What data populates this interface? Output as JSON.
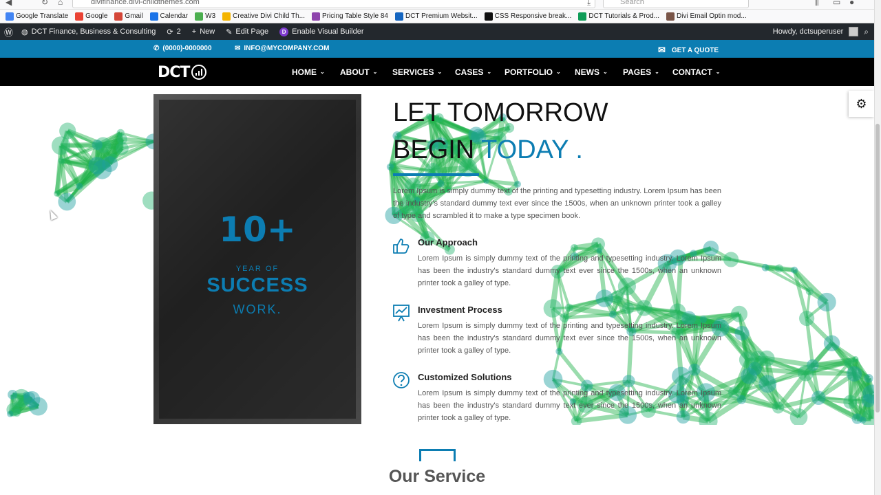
{
  "browser": {
    "url": "divifinance.divi-childthemes.com",
    "search_placeholder": "Search",
    "bookmarks": [
      {
        "label": "Google Translate",
        "icon": "translate-icon",
        "color": "#4285f4"
      },
      {
        "label": "Google",
        "icon": "google-icon",
        "color": "#ea4335"
      },
      {
        "label": "Gmail",
        "icon": "gmail-icon",
        "color": "#d44638"
      },
      {
        "label": "Calendar",
        "icon": "calendar-icon",
        "color": "#1a73e8"
      },
      {
        "label": "W3",
        "icon": "w3-icon",
        "color": "#4caf50"
      },
      {
        "label": "Creative Divi Child Th...",
        "icon": "pencil-icon",
        "color": "#f4b400"
      },
      {
        "label": "Pricing Table Style 84",
        "icon": "jr-icon",
        "color": "#8e44ad"
      },
      {
        "label": "DCT Premium Websit...",
        "icon": "dct-icon",
        "color": "#1565c0"
      },
      {
        "label": "CSS Responsive break...",
        "icon": "github-icon",
        "color": "#111111"
      },
      {
        "label": "DCT Tutorials & Prod...",
        "icon": "sheet-icon",
        "color": "#0f9d58"
      },
      {
        "label": "Divi Email Optin mod...",
        "icon": "gear-icon",
        "color": "#795548"
      }
    ]
  },
  "adminbar": {
    "site_name": "DCT Finance, Business & Consulting",
    "updates_count": "2",
    "new_label": "New",
    "edit_label": "Edit Page",
    "visual_builder_label": "Enable Visual Builder",
    "greeting": "Howdy, dctsuperuser"
  },
  "topbar": {
    "phone": "(0000)-0000000",
    "email": "INFO@MYCOMPANY.COM",
    "quote": "GET A QUOTE"
  },
  "header": {
    "logo_text": "DCT",
    "menu": [
      "HOME",
      "ABOUT",
      "SERVICES",
      "CASES",
      "PORTFOLIO",
      "NEWS",
      "PAGES",
      "CONTACT"
    ]
  },
  "hero": {
    "stat_number": "10+",
    "stat_line1": "YEAR OF",
    "stat_line2": "SUCCESS",
    "stat_line3": "WORK.",
    "heading_line1": "LET TOMORROW",
    "heading_line2_a": "BEGIN ",
    "heading_line2_b": "TODAY .",
    "intro": "Lorem Ipsum is simply dummy text of the printing and typesetting industry. Lorem Ipsum has been the industry's standard dummy text ever since the 1500s, when an unknown printer took a galley of type and scrambled it to make a type specimen book.",
    "features": [
      {
        "title": "Our Approach",
        "icon": "thumbs-up-icon",
        "body": "Lorem Ipsum is simply dummy text of the printing and typesetting industry. Lorem Ipsum has been the industry's standard dummy text ever since the 1500s, when an unknown printer took a galley of type."
      },
      {
        "title": "Investment Process",
        "icon": "chart-board-icon",
        "body": "Lorem Ipsum is simply dummy text of the printing and typesetting industry. Lorem Ipsum has been the industry's standard dummy text ever since the 1500s, when an unknown printer took a galley of type."
      },
      {
        "title": "Customized Solutions",
        "icon": "question-circle-icon",
        "body": "Lorem Ipsum is simply dummy text of the printing and typesetting industry. Lorem Ipsum has been the industry's standard dummy text ever since the 1500s, when an unknown printer took a galley of type."
      }
    ]
  },
  "service": {
    "title": "Our Service"
  },
  "colors": {
    "accent": "#0c7db2",
    "network": "#1fb14a",
    "adminbar": "#23282d"
  }
}
